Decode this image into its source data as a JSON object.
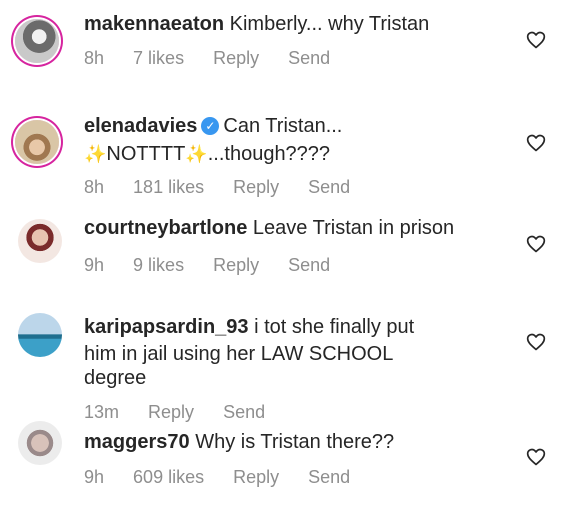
{
  "comments": [
    {
      "username": "makennaeaton",
      "lines": [
        "Kimberly... why Tristan"
      ],
      "time": "8h",
      "likes": "7 likes",
      "reply": "Reply",
      "send": "Send"
    },
    {
      "username": "elenadavies",
      "verified": true,
      "lines": [
        "Can Tristan...",
        "NOTTTT",
        "...though????"
      ],
      "time": "8h",
      "likes": "181 likes",
      "reply": "Reply",
      "send": "Send"
    },
    {
      "username": "courtneybartlone",
      "lines": [
        "Leave Tristan in prison"
      ],
      "time": "9h",
      "likes": "9 likes",
      "reply": "Reply",
      "send": "Send"
    },
    {
      "username": "karipapsardin_93",
      "lines": [
        "i tot she finally put",
        "him in jail using her LAW SCHOOL",
        "degree"
      ],
      "time": "13m",
      "reply": "Reply",
      "send": "Send"
    },
    {
      "username": "maggers70",
      "lines": [
        "Why is Tristan there??"
      ],
      "time": "9h",
      "likes": "609 likes",
      "reply": "Reply",
      "send": "Send"
    }
  ],
  "icons": {
    "heart": "heart-outline-icon",
    "verified": "verified-badge-icon",
    "sparkle": "sparkles-emoji-icon"
  }
}
